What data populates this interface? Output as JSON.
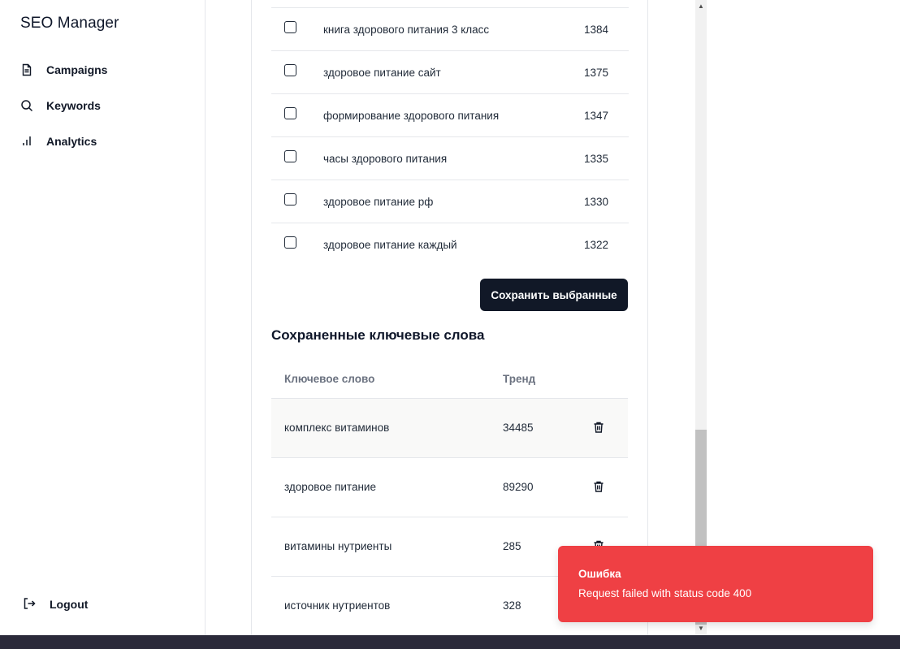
{
  "sidebar": {
    "brand": "SEO Manager",
    "items": [
      {
        "label": "Campaigns",
        "icon": "document-icon"
      },
      {
        "label": "Keywords",
        "icon": "search-icon"
      },
      {
        "label": "Analytics",
        "icon": "bar-chart-icon"
      }
    ],
    "logout_label": "Logout"
  },
  "keyword_suggestions": [
    {
      "keyword": "книга здорового питания 3 класс",
      "volume": "1384"
    },
    {
      "keyword": "здоровое питание сайт",
      "volume": "1375"
    },
    {
      "keyword": "формирование здорового питания",
      "volume": "1347"
    },
    {
      "keyword": "часы здорового питания",
      "volume": "1335"
    },
    {
      "keyword": "здоровое питание рф",
      "volume": "1330"
    },
    {
      "keyword": "здоровое питание каждый",
      "volume": "1322"
    }
  ],
  "save_button_label": "Сохранить выбранные",
  "saved": {
    "title": "Сохраненные ключевые слова",
    "headers": {
      "keyword": "Ключевое слово",
      "trend": "Тренд"
    },
    "rows": [
      {
        "keyword": "комплекс витаминов",
        "trend": "34485"
      },
      {
        "keyword": "здоровое питание",
        "trend": "89290"
      },
      {
        "keyword": "витамины нутриенты",
        "trend": "285"
      },
      {
        "keyword": "источник нутриентов",
        "trend": "328"
      }
    ]
  },
  "toast": {
    "title": "Ошибка",
    "message": "Request failed with status code 400",
    "color": "#ef4044"
  },
  "colors": {
    "primary_button": "#111827",
    "error": "#ef4044"
  }
}
